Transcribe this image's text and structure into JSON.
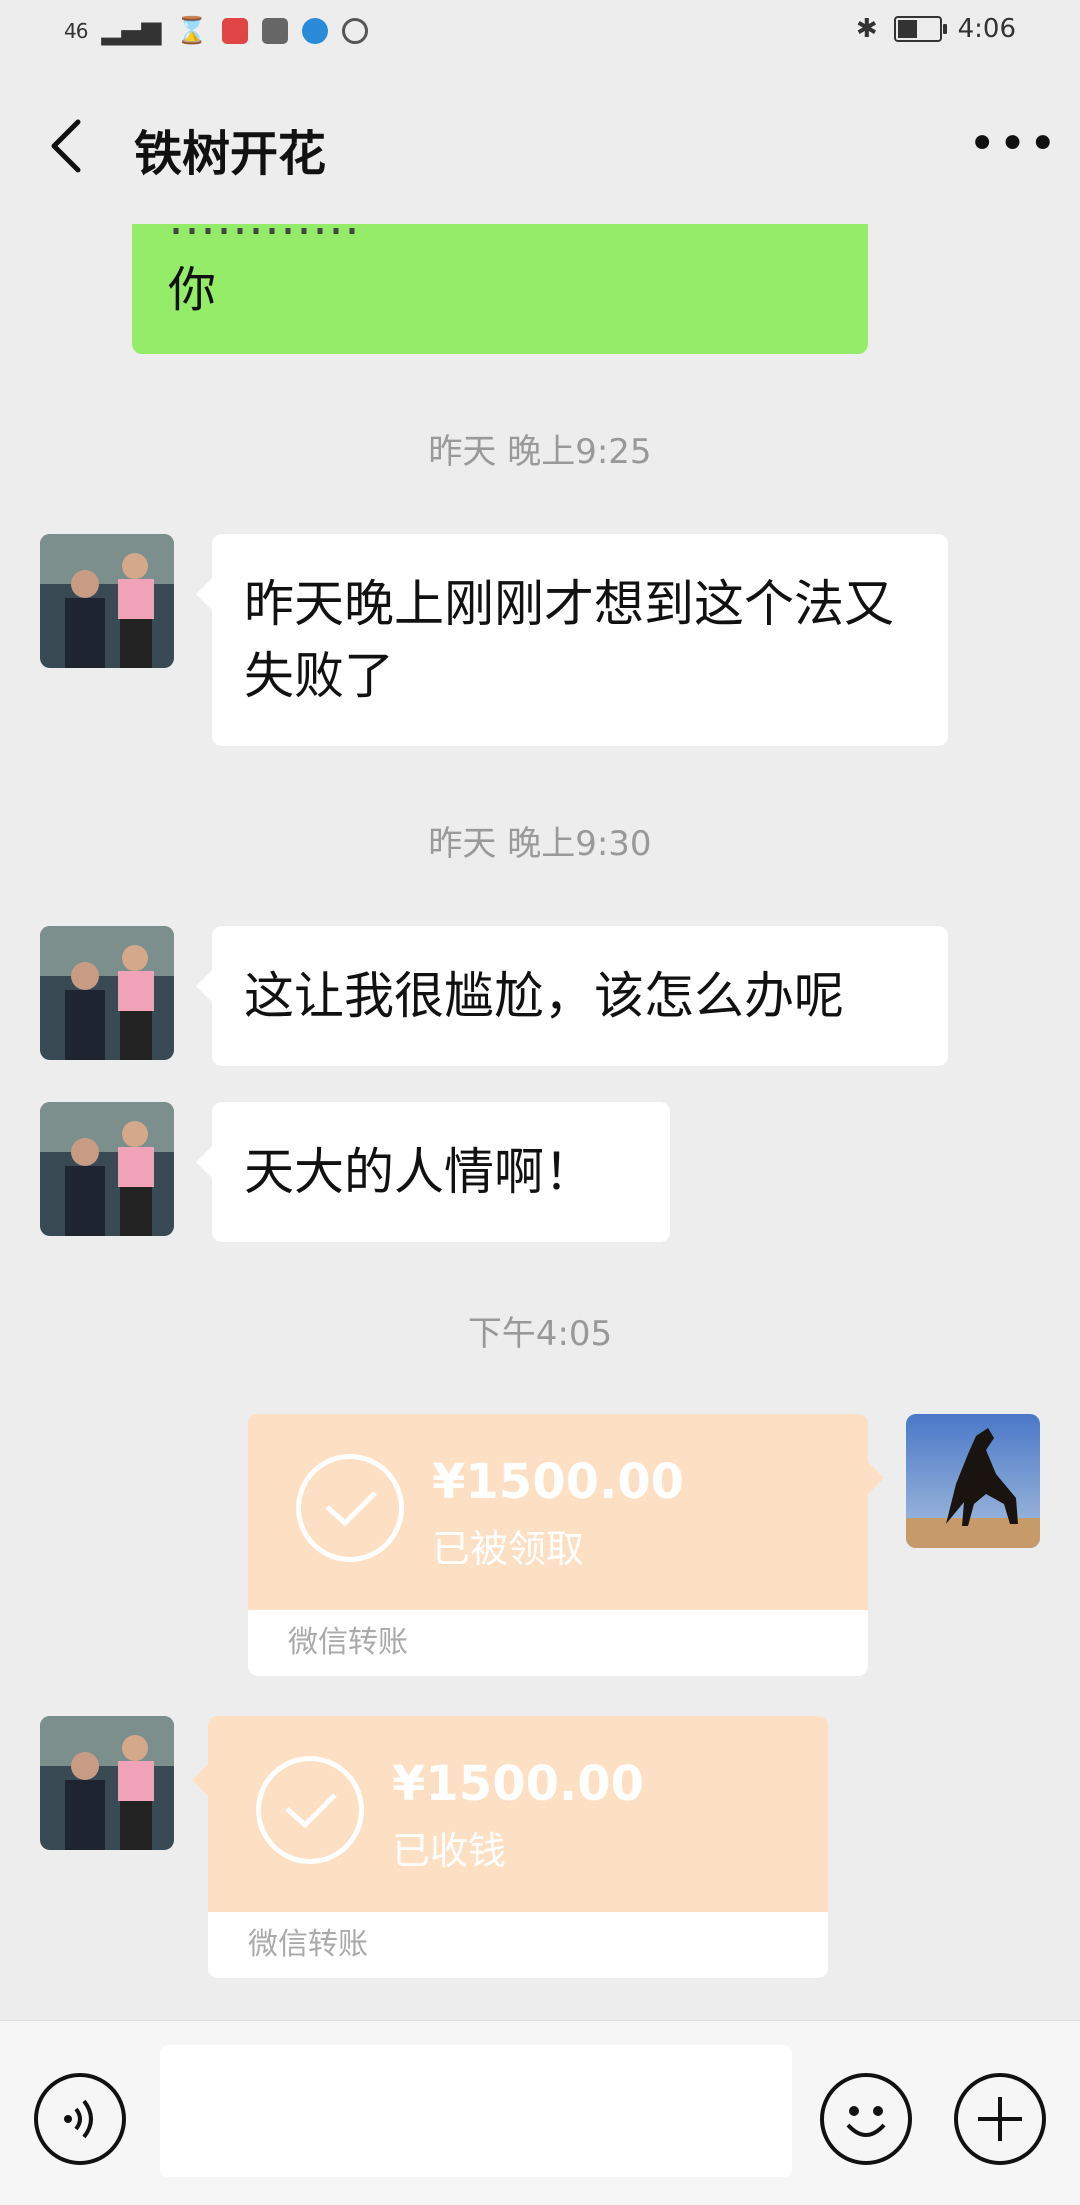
{
  "status_bar": {
    "signal": "46",
    "time": "4:06"
  },
  "header": {
    "title": "铁树开花"
  },
  "messages": {
    "partial_green_text": "你",
    "ts1": "昨天 晚上9:25",
    "msg1": "昨天晚上刚刚才想到这个法又失败了",
    "ts2": "昨天 晚上9:30",
    "msg2": "这让我很尴尬，该怎么办呢",
    "msg3": "天大的人情啊！",
    "ts3": "下午4:05"
  },
  "transfer_sent": {
    "amount": "¥1500.00",
    "status": "已被领取",
    "label": "微信转账"
  },
  "transfer_received": {
    "amount": "¥1500.00",
    "status": "已收钱",
    "label": "微信转账"
  },
  "colors": {
    "background": "#ededed",
    "own_bubble": "#95ec69",
    "other_bubble": "#ffffff",
    "transfer_card": "#fde0c3"
  },
  "icons": [
    "back-arrow-icon",
    "more-icon",
    "voice-icon",
    "emoji-icon",
    "plus-icon",
    "check-circle-icon",
    "battery-icon",
    "bluetooth-icon"
  ]
}
